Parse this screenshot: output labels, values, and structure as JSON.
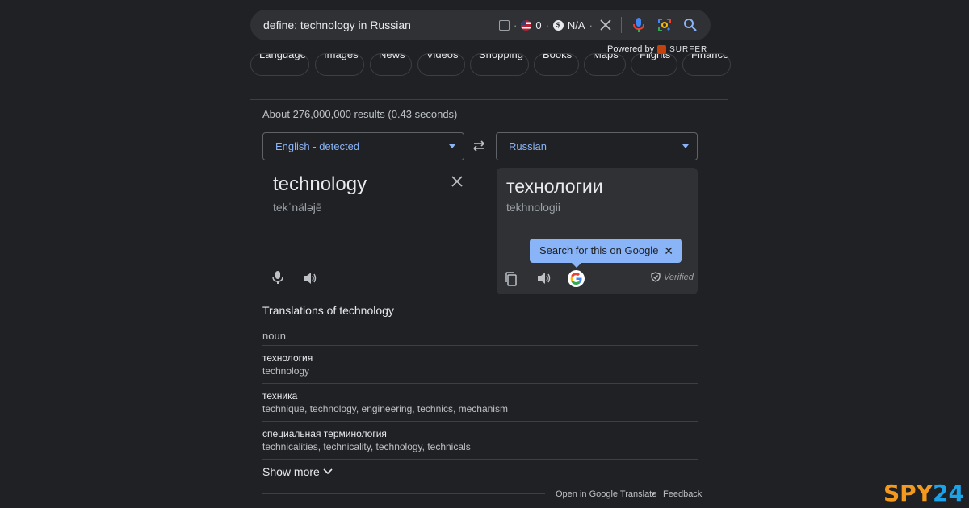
{
  "search": {
    "query": "define: technology in Russian",
    "ext_count": "0",
    "ext_value": "N/A",
    "powered_by": "Powered by",
    "surfer": "SURFER"
  },
  "tabs": [
    "Language",
    "Images",
    "News",
    "Videos",
    "Shopping",
    "Books",
    "Maps",
    "Flights",
    "Finance"
  ],
  "stats": "About 276,000,000 results (0.43 seconds)",
  "translator": {
    "source_lang": "English - detected",
    "target_lang": "Russian",
    "source_word": "technology",
    "source_phonetic": "tekˈnäləjē",
    "target_word": "технологии",
    "target_romanization": "tekhnologii",
    "tooltip": "Search for this on Google",
    "verified": "Verified"
  },
  "translations": {
    "title": "Translations of technology",
    "pos": "noun",
    "entries": [
      {
        "word": "технология",
        "meanings": "technology"
      },
      {
        "word": "техника",
        "meanings": "technique, technology, engineering, technics, mechanism"
      },
      {
        "word": "специальная терминология",
        "meanings": "technicalities, technicality, technology, technicals"
      }
    ],
    "show_more": "Show more"
  },
  "footer": {
    "open_translate": "Open in Google Translate",
    "sep": "•",
    "feedback": "Feedback"
  },
  "watermark": {
    "spy": "SPY",
    "num": "24"
  },
  "colors": {
    "background": "#202124",
    "accent": "#8ab4f8",
    "surface": "#303134"
  }
}
